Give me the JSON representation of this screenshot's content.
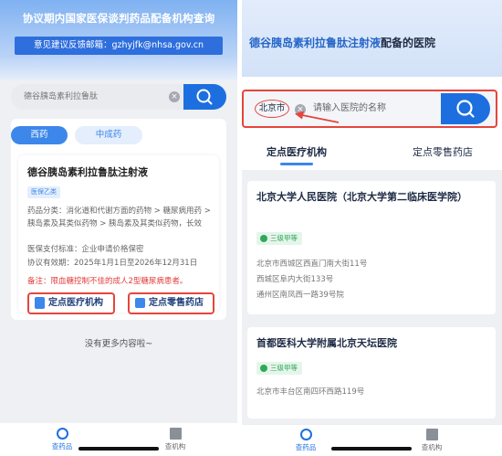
{
  "left": {
    "header": {
      "title": "协议期内国家医保谈判药品配备机构查询",
      "feedback": "意见建议反馈邮箱：gzhyjfk@nhsa.gov.cn"
    },
    "search": {
      "value": "德谷胰岛素利拉鲁肽",
      "clear_icon": "×"
    },
    "tabs": [
      {
        "label": "西药",
        "active": true
      },
      {
        "label": "中成药",
        "active": false
      }
    ],
    "drug": {
      "name": "德谷胰岛素利拉鲁肽注射液",
      "badge": "医保乙类",
      "category": "药品分类：消化道和代谢方面的药物 > 糖尿病用药 > 胰岛素及其类似药物 > 胰岛素及其类似药物，长效",
      "payment": "医保支付标准：企业申请价格保密",
      "validity": "协议有效期：2025年1月1日至2026年12月31日",
      "note": "备注：限血糖控制不佳的成人2型糖尿病患者。",
      "btn_institution": "定点医疗机构",
      "btn_pharmacy": "定点零售药店"
    },
    "no_more": "没有更多内容啦~",
    "tabbar": [
      {
        "label": "查药品",
        "active": true
      },
      {
        "label": "查机构",
        "active": false
      }
    ]
  },
  "right": {
    "title_drug": "德谷胰岛素利拉鲁肽注射液",
    "title_suffix": "配备的医院",
    "search": {
      "city": "北京市",
      "clear_icon": "×",
      "placeholder": "请输入医院的名称"
    },
    "tabs": [
      {
        "label": "定点医疗机构",
        "active": true
      },
      {
        "label": "定点零售药店",
        "active": false
      }
    ],
    "hospitals": [
      {
        "name": "北京大学人民医院（北京大学第二临床医学院）",
        "level": "三级甲等",
        "addresses": [
          "北京市西城区西直门南大街11号",
          "西城区阜内大街133号",
          "通州区南凤西一路39号院"
        ]
      },
      {
        "name": "首都医科大学附属北京天坛医院",
        "level": "三级甲等",
        "addresses": [
          "北京市丰台区南四环西路119号"
        ]
      }
    ],
    "tabbar": [
      {
        "label": "查药品",
        "active": true
      },
      {
        "label": "查机构",
        "active": false
      }
    ]
  },
  "colors": {
    "primary": "#1d6fe0",
    "highlight_red": "#e6453c",
    "badge_green": "#2fa85a"
  },
  "icons": [
    "search-icon",
    "clear-icon",
    "hospital-icon",
    "pharmacy-icon",
    "medicine-tab-icon",
    "institution-tab-icon"
  ]
}
